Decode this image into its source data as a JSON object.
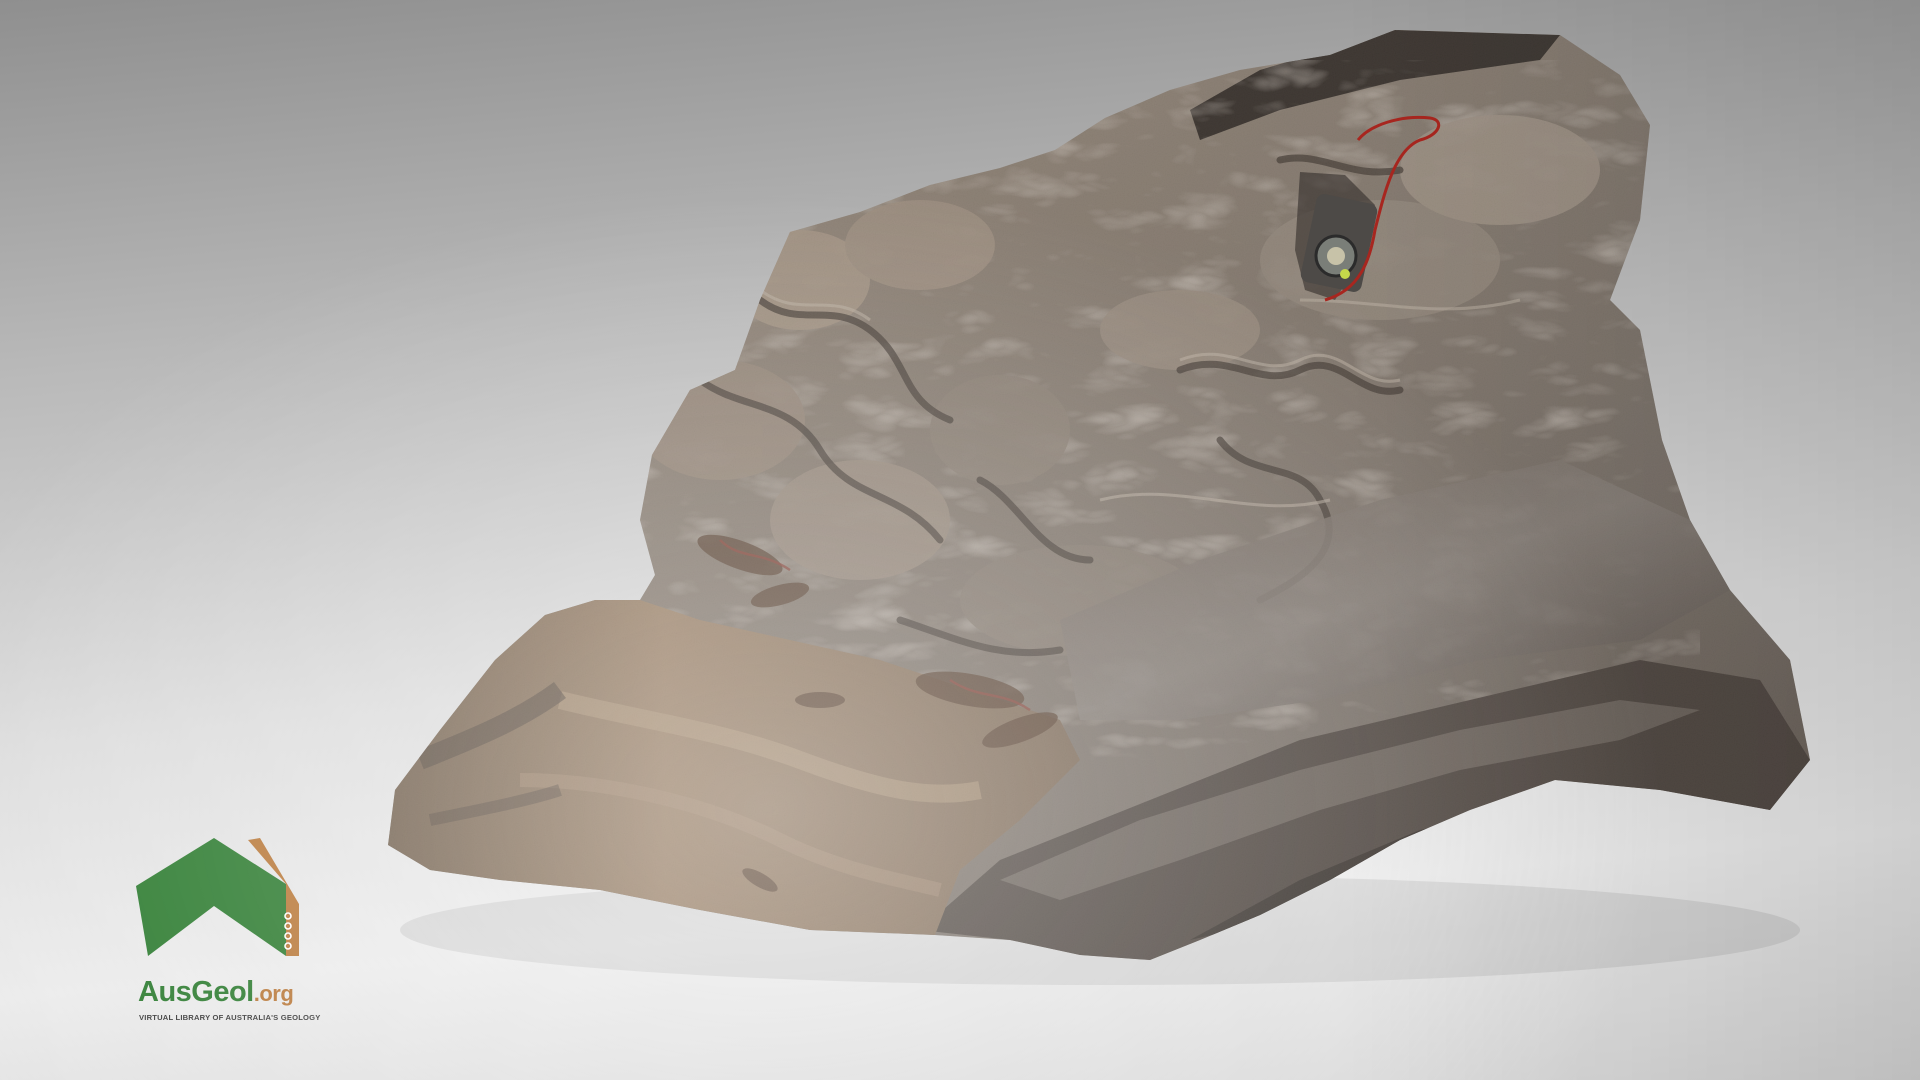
{
  "scene": {
    "subject_icon": "rock-outcrop-3d-model",
    "compass_icon": "geological-compass-icon",
    "background_top": "#8f8f8f",
    "background_bottom": "#ececec"
  },
  "logo": {
    "word_main": "AusGeol",
    "word_suffix": ".org",
    "tagline": "VIRTUAL LIBRARY OF AUSTRALIA'S GEOLOGY",
    "primary_color": "#2f7d32",
    "secondary_color": "#b9793a"
  }
}
